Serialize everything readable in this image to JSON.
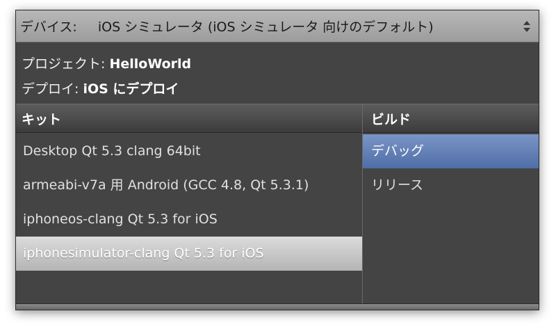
{
  "device": {
    "label": "デバイス:",
    "value": "iOS シミュレータ (iOS シミュレータ 向けのデフォルト)"
  },
  "info": {
    "project_label": "プロジェクト: ",
    "project_value": "HelloWorld",
    "deploy_label": "デプロイ: ",
    "deploy_value": "iOS にデプロイ"
  },
  "kit_column": {
    "header": "キット",
    "items": [
      "Desktop Qt 5.3 clang 64bit",
      "armeabi-v7a 用 Android (GCC 4.8, Qt 5.3.1)",
      "iphoneos-clang Qt 5.3 for iOS",
      "iphonesimulator-clang Qt 5.3 for iOS"
    ],
    "selected_index": 3
  },
  "build_column": {
    "header": "ビルド",
    "items": [
      "デバッグ",
      "リリース"
    ],
    "selected_index": 0
  },
  "colors": {
    "panel_bg": "#444444",
    "kit_selected": "#c8c8c8",
    "build_selected": "#5f7fb6"
  }
}
